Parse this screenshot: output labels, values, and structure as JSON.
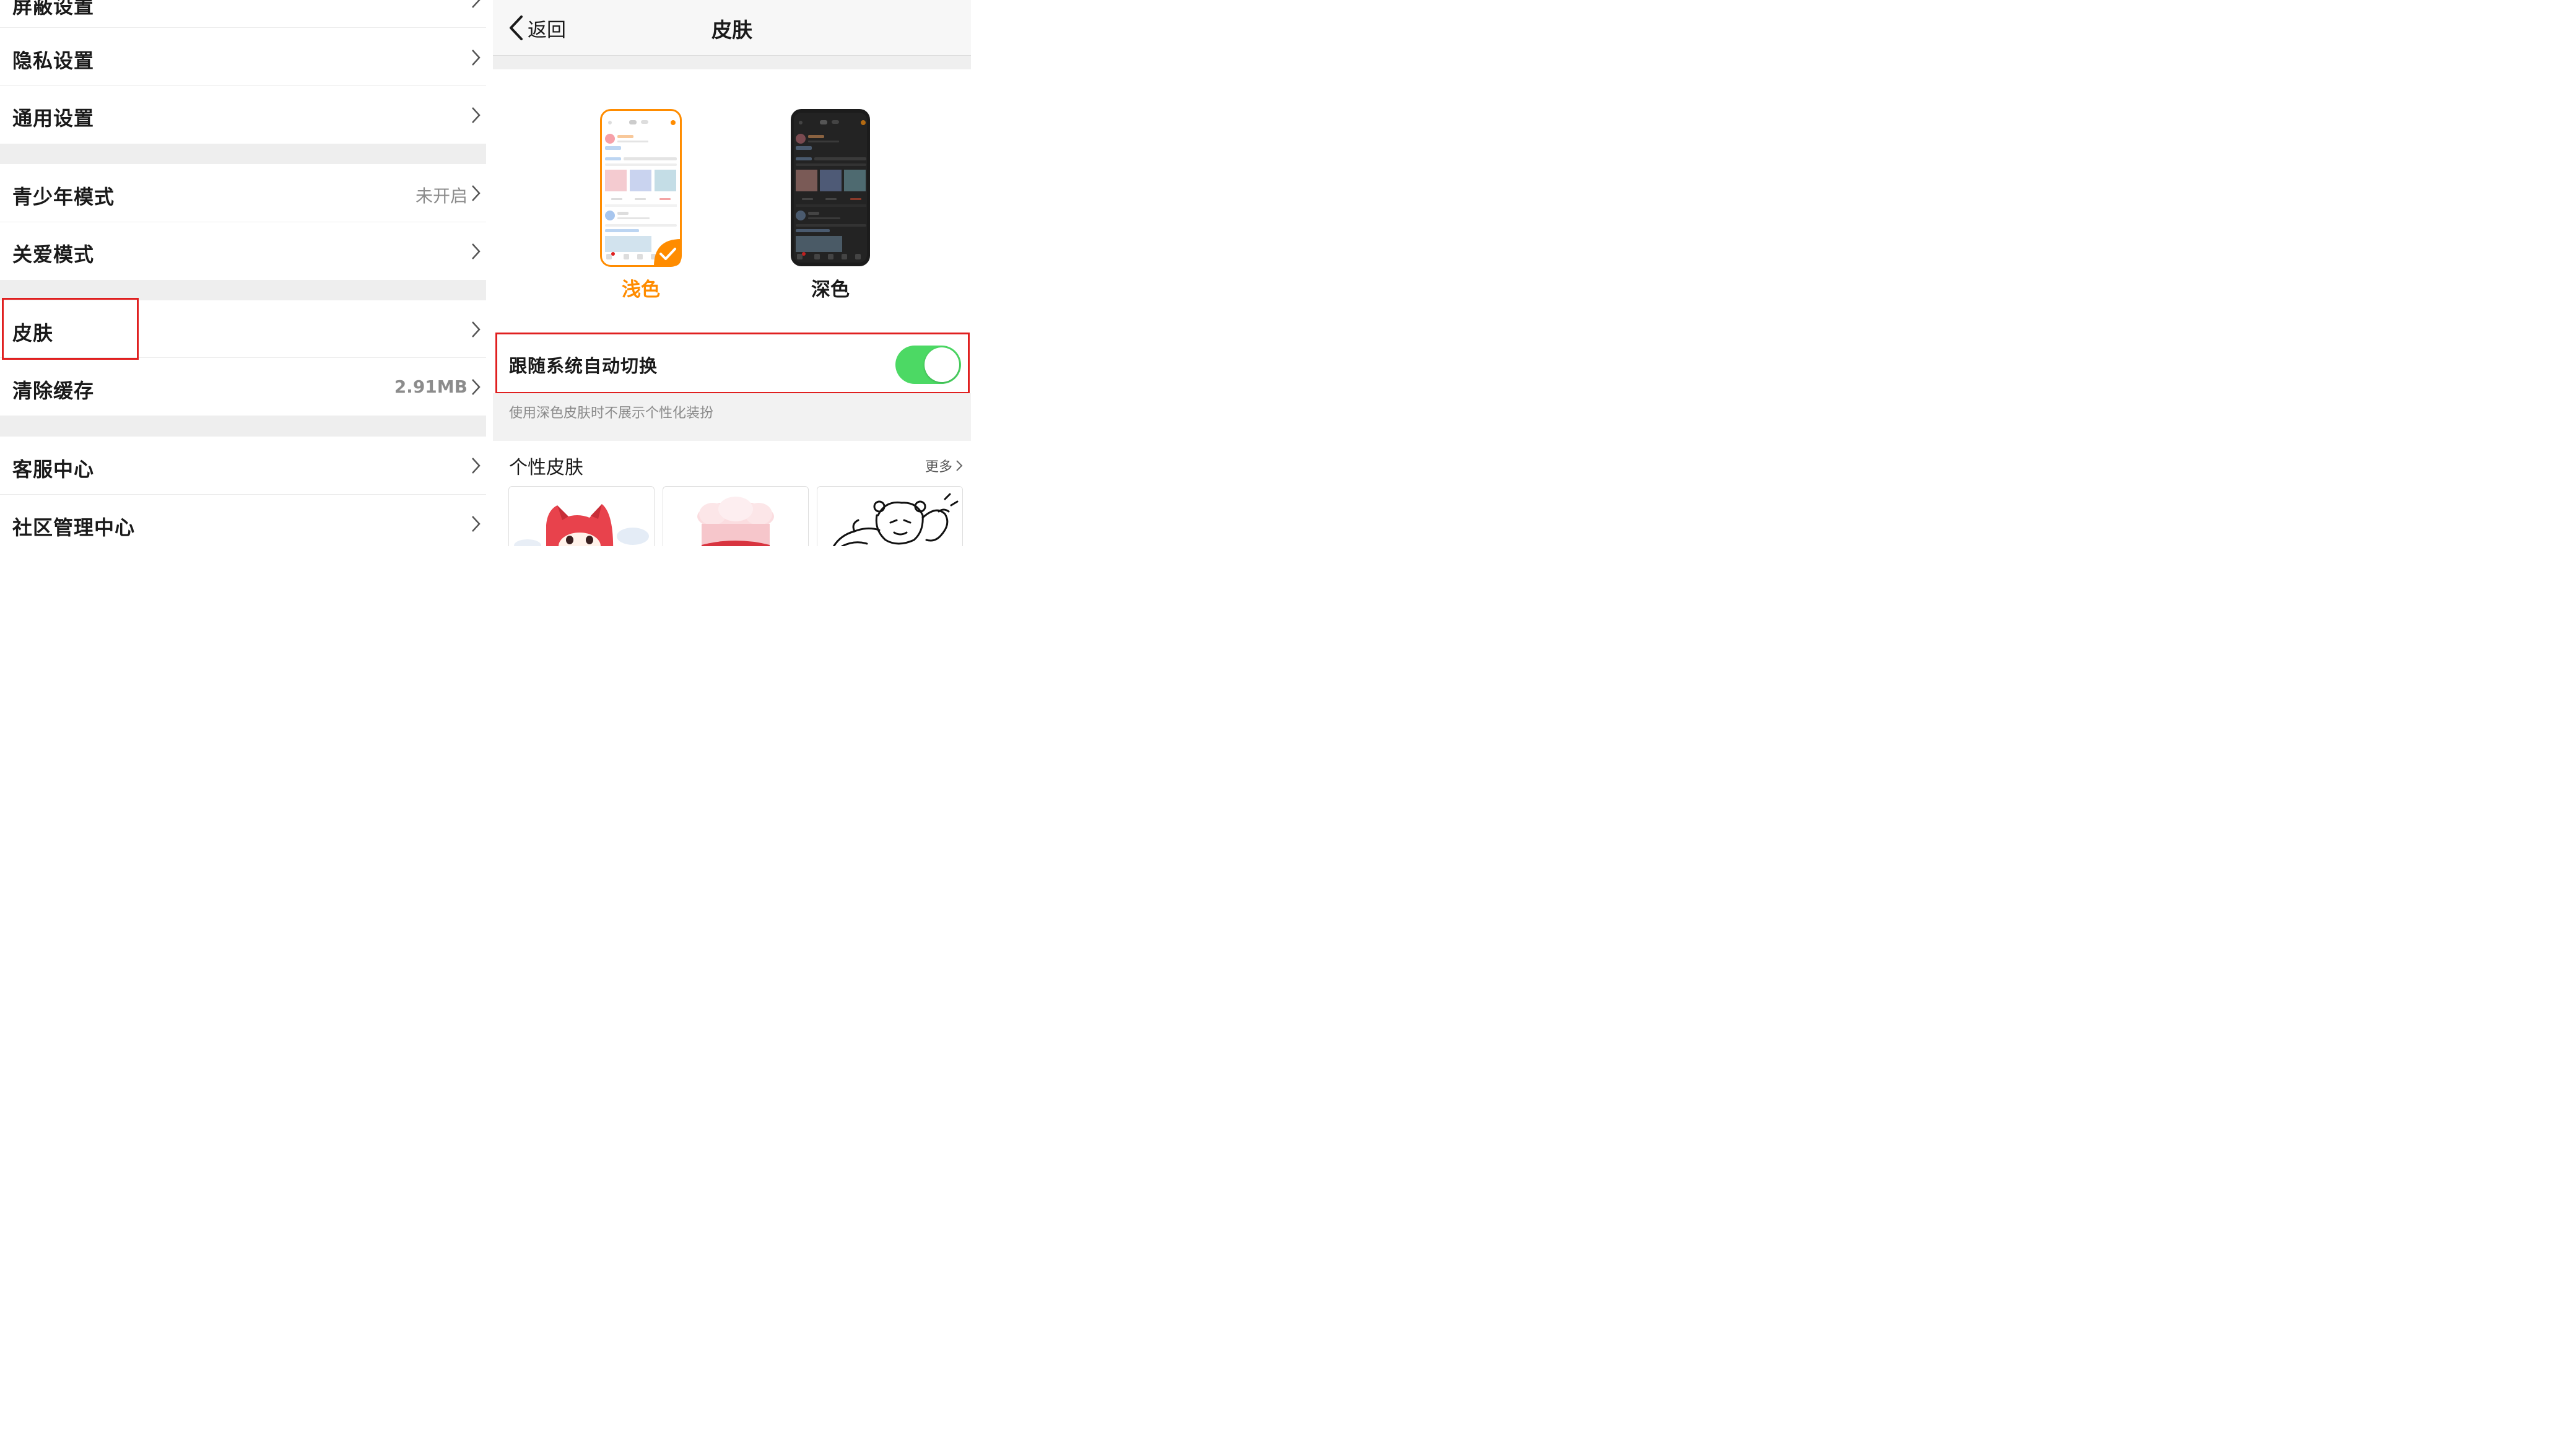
{
  "left": {
    "rows": [
      {
        "label": "屏蔽设置",
        "value": ""
      },
      {
        "label": "隐私设置",
        "value": ""
      },
      {
        "label": "通用设置",
        "value": ""
      },
      {
        "label": "青少年模式",
        "value": "未开启"
      },
      {
        "label": "关爱模式",
        "value": ""
      },
      {
        "label": "皮肤",
        "value": ""
      },
      {
        "label": "清除缓存",
        "value": "2.91MB"
      },
      {
        "label": "客服中心",
        "value": ""
      },
      {
        "label": "社区管理中心",
        "value": ""
      }
    ]
  },
  "right": {
    "nav": {
      "back_label": "返回",
      "title": "皮肤"
    },
    "skins": [
      {
        "label": "浅色",
        "selected": true
      },
      {
        "label": "深色",
        "selected": false
      }
    ],
    "auto_switch": {
      "label": "跟随系统自动切换",
      "enabled": true
    },
    "hint": "使用深色皮肤时不展示个性化装扮",
    "personal_skins": {
      "title": "个性皮肤",
      "more_label": "更多"
    }
  },
  "colors": {
    "accent": "#ff8c00",
    "toggle_on": "#4cd964",
    "highlight": "#e02020"
  }
}
